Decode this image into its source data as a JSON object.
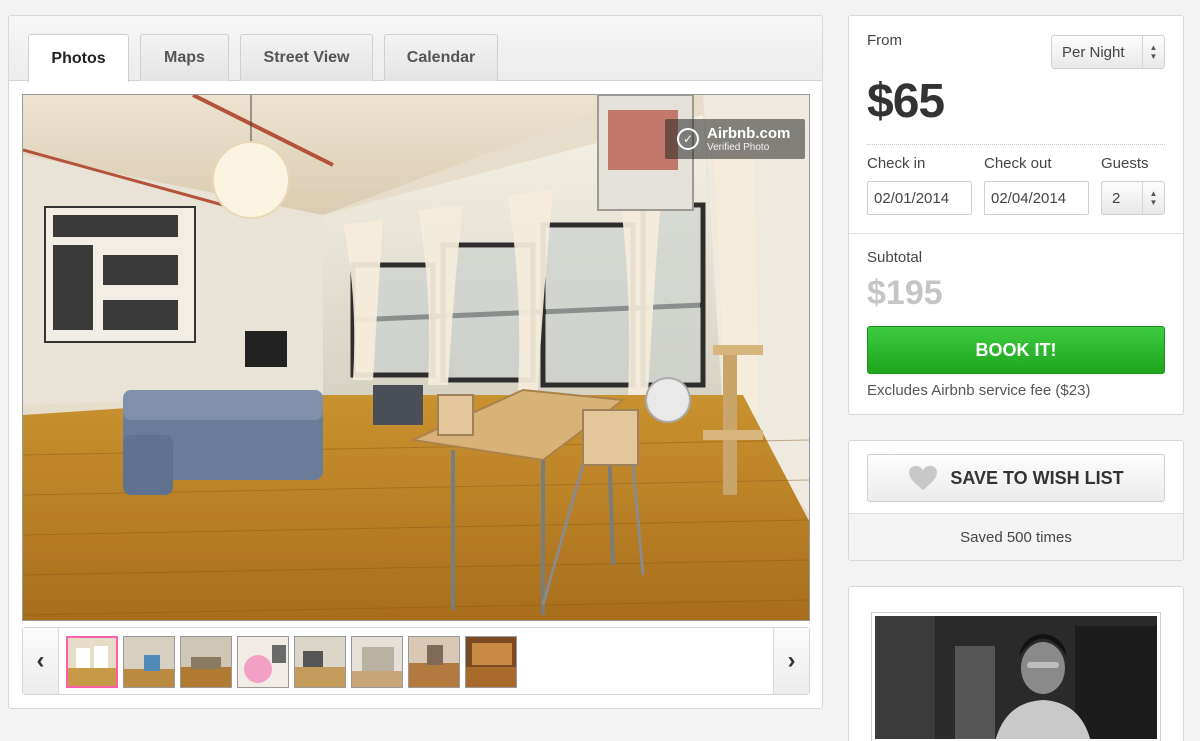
{
  "tabs": [
    {
      "label": "Photos",
      "active": true
    },
    {
      "label": "Maps",
      "active": false
    },
    {
      "label": "Street View",
      "active": false
    },
    {
      "label": "Calendar",
      "active": false
    }
  ],
  "photo_badge": {
    "line1": "Airbnb.com",
    "line2": "Verified Photo"
  },
  "gallery": {
    "prev_icon": "chevron-left-icon",
    "next_icon": "chevron-right-icon",
    "thumbnail_count": 8,
    "active_thumbnail": 1
  },
  "booking": {
    "from_label": "From",
    "price": "$65",
    "rate_select": "Per Night",
    "checkin_label": "Check in",
    "checkout_label": "Check out",
    "guests_label": "Guests",
    "checkin_value": "02/01/2014",
    "checkout_value": "02/04/2014",
    "guests_value": "2",
    "subtotal_label": "Subtotal",
    "subtotal_value": "$195",
    "book_button": "BOOK IT!",
    "fee_note": "Excludes Airbnb service fee ($23)"
  },
  "wishlist": {
    "button_label": "SAVE TO WISH LIST",
    "saved_text": "Saved 500 times"
  },
  "colors": {
    "book_green": "#2bb82b",
    "active_thumb_border": "#ff5fa9",
    "subtotal_gray": "#c5c5c5"
  }
}
